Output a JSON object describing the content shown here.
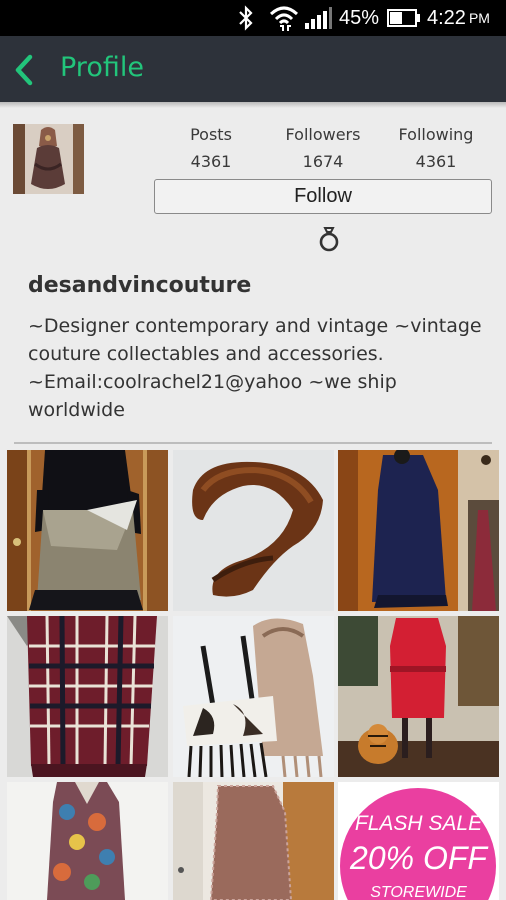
{
  "status_bar": {
    "battery_percent": "45%",
    "time": "4:22",
    "ampm": "PM",
    "icons": [
      "bluetooth-icon",
      "wifi-icon",
      "signal-icon",
      "battery-icon"
    ]
  },
  "app_bar": {
    "title": "Profile",
    "back_icon": "chevron-left-icon",
    "accent_color": "#22c57b",
    "background_color": "#2d323a"
  },
  "profile": {
    "username": "desandvincouture",
    "bio": "~Designer contemporary and vintage ~vintage couture collectables and accessories. ~Email:coolrachel21@yahoo ~we ship worldwide",
    "stats": [
      {
        "label": "Posts",
        "value": "4361"
      },
      {
        "label": "Followers",
        "value": "1674"
      },
      {
        "label": "Following",
        "value": "4361"
      }
    ],
    "follow_label": "Follow",
    "ring_icon": "ring-icon"
  },
  "grid": {
    "items": [
      {
        "description_icon": "dress-photo"
      },
      {
        "description_icon": "fur-collar-photo"
      },
      {
        "description_icon": "navy-coat-photo"
      },
      {
        "description_icon": "plaid-scarf-photo"
      },
      {
        "description_icon": "fringe-bags-photo"
      },
      {
        "description_icon": "red-dress-photo"
      },
      {
        "description_icon": "floral-dress-photo"
      },
      {
        "description_icon": "lace-dress-photo"
      },
      {
        "flash_sale_line1": "FLASH SALE",
        "flash_sale_line2": "20% OFF",
        "flash_sale_line3": "STOREWIDE"
      }
    ]
  }
}
